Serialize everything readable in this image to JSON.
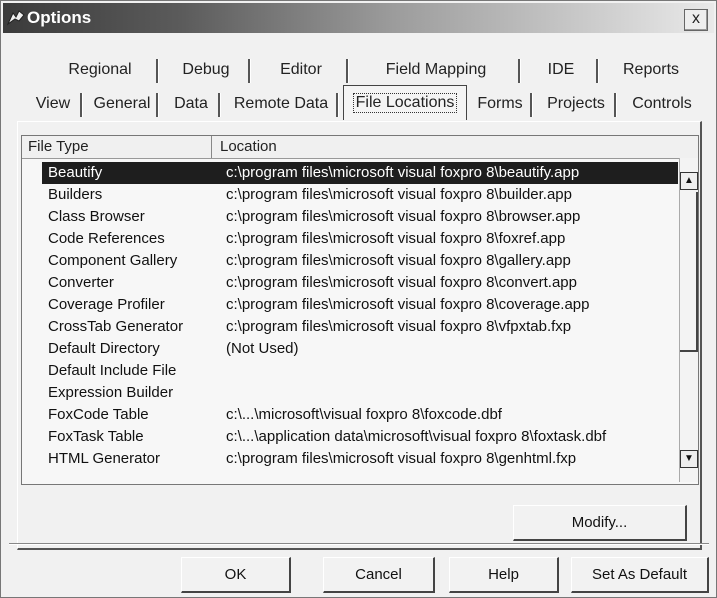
{
  "window": {
    "title": "Options",
    "close_label": "x"
  },
  "tabs": {
    "row1": [
      "Regional",
      "Debug",
      "Editor",
      "Field Mapping",
      "IDE",
      "Reports"
    ],
    "row2": [
      "View",
      "General",
      "Data",
      "Remote Data",
      "File Locations",
      "Forms",
      "Projects",
      "Controls"
    ],
    "active": "File Locations"
  },
  "list": {
    "headers": {
      "file_type": "File Type",
      "location": "Location"
    },
    "rows": [
      {
        "type": "Beautify",
        "location": "c:\\program files\\microsoft visual foxpro 8\\beautify.app"
      },
      {
        "type": "Builders",
        "location": "c:\\program files\\microsoft visual foxpro 8\\builder.app"
      },
      {
        "type": "Class Browser",
        "location": "c:\\program files\\microsoft visual foxpro 8\\browser.app"
      },
      {
        "type": "Code References",
        "location": "c:\\program files\\microsoft visual foxpro 8\\foxref.app"
      },
      {
        "type": "Component Gallery",
        "location": "c:\\program files\\microsoft visual foxpro 8\\gallery.app"
      },
      {
        "type": "Converter",
        "location": "c:\\program files\\microsoft visual foxpro 8\\convert.app"
      },
      {
        "type": "Coverage Profiler",
        "location": "c:\\program files\\microsoft visual foxpro 8\\coverage.app"
      },
      {
        "type": "CrossTab Generator",
        "location": "c:\\program files\\microsoft visual foxpro 8\\vfpxtab.fxp"
      },
      {
        "type": "Default Directory",
        "location": "(Not Used)"
      },
      {
        "type": "Default Include File",
        "location": ""
      },
      {
        "type": "Expression Builder",
        "location": ""
      },
      {
        "type": "FoxCode Table",
        "location": "c:\\...\\microsoft\\visual foxpro 8\\foxcode.dbf"
      },
      {
        "type": "FoxTask Table",
        "location": "c:\\...\\application data\\microsoft\\visual foxpro 8\\foxtask.dbf"
      },
      {
        "type": "HTML Generator",
        "location": "c:\\program files\\microsoft visual foxpro 8\\genhtml.fxp"
      }
    ],
    "selected_index": 0
  },
  "buttons": {
    "modify": "Modify...",
    "ok": "OK",
    "cancel": "Cancel",
    "help": "Help",
    "set_default": "Set As Default"
  },
  "icons": {
    "app": "fox-icon",
    "close": "close-icon",
    "scroll_up": "up-arrow-icon",
    "scroll_down": "down-arrow-icon"
  }
}
